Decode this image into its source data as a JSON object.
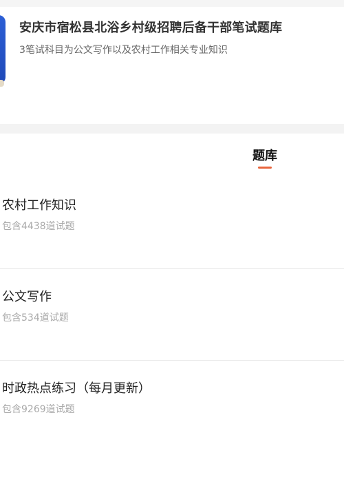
{
  "header": {
    "title": "安庆市宿松县北浴乡村级招聘后备干部笔试题库",
    "subtitle": "3笔试科目为公文写作以及农村工作相关专业知识",
    "icon": "book-icon"
  },
  "tabs": {
    "active_label": "题库"
  },
  "banks": [
    {
      "name": "农村工作知识",
      "count_text": "包含4438道试题"
    },
    {
      "name": "公文写作",
      "count_text": "包含534道试题"
    },
    {
      "name": "时政热点练习（每月更新）",
      "count_text": "包含9269道试题"
    }
  ],
  "colors": {
    "accent": "#e8643c",
    "book_blue": "#2c5fd6",
    "muted_text": "#aaaaaa"
  }
}
